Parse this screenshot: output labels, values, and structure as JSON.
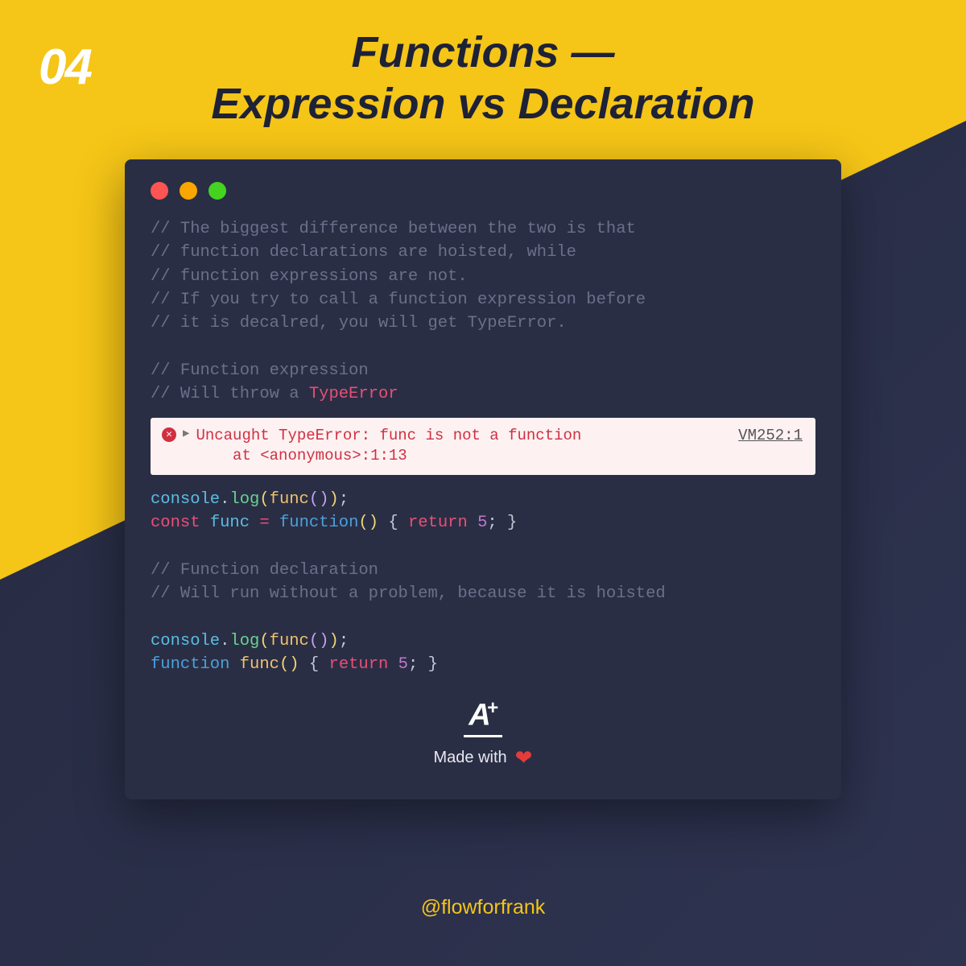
{
  "pageNumber": "04",
  "title_line1": "Functions —",
  "title_line2": "Expression vs Declaration",
  "comments_block1": [
    "// The biggest difference between the two is that",
    "// function declarations are hoisted, while",
    "// function expressions are not.",
    "// If you try to call a function expression before",
    "// it is decalred, you will get TypeError."
  ],
  "comments_block2_l1": "// Function expression",
  "comments_block2_l2_prefix": "// Will throw a ",
  "comments_block2_l2_hl": "TypeError",
  "error": {
    "line1": "Uncaught TypeError: func is not a function",
    "line2": "    at <anonymous>:1:13",
    "source": "VM252:1"
  },
  "expr_code": {
    "console": "console",
    "log": "log",
    "func": "func",
    "const": "const",
    "function": "function",
    "return": "return",
    "five": "5"
  },
  "comments_block3": [
    "// Function declaration",
    "// Will run without a problem, because it is hoisted"
  ],
  "footer": {
    "logo": "A",
    "plus": "+",
    "made": "Made with",
    "handle": "@flowforfrank"
  }
}
